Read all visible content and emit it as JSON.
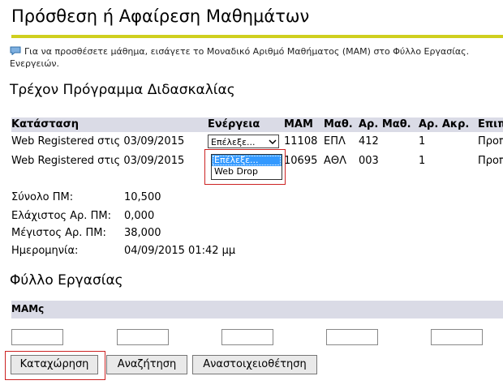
{
  "page": {
    "title": "Πρόσθεση ή Αφαίρεση Μαθημάτων"
  },
  "info": {
    "text": "Για να προσθέσετε μάθημα, εισάγετε το Μοναδικό Αριθμό Μαθήματος (MAM) στο Φύλλο Εργασίας. Ενεργειών."
  },
  "schedule": {
    "heading": "Τρέχον Πρόγραμμα Διδασκαλίας",
    "columns": [
      "Κατάσταση",
      "Ενέργεια",
      "MAM",
      "Μαθ.",
      "Αρ. Μαθ.",
      "Αρ. Ακρ.",
      "Επιπ"
    ],
    "rows": [
      {
        "status": "Web Registered στις 03/09/2015",
        "action": "Επέλεξε...",
        "mam": "11108",
        "subject": "ΕΠΛ",
        "course_no": "412",
        "section": "1",
        "level": "Προπ"
      },
      {
        "status": "Web Registered στις 03/09/2015",
        "action": "",
        "mam": "10695",
        "subject": "ΑΘΛ",
        "course_no": "003",
        "section": "1",
        "level": "Προπ"
      }
    ],
    "dropdown_options": [
      "Επέλεξε...",
      "Web Drop"
    ],
    "dropdown_selected_index": 0
  },
  "stats": [
    {
      "label": "Σύνολο ΠΜ:",
      "value": "10,500"
    },
    {
      "label": "Ελάχιστος Αρ. ΠΜ:",
      "value": "0,000"
    },
    {
      "label": "Μέγιστος Αρ. ΠΜ:",
      "value": "38,000"
    },
    {
      "label": "Ημερομηνία:",
      "value": "04/09/2015 01:42 μμ"
    }
  ],
  "worksheet": {
    "heading": "Φύλλο Εργασίας",
    "mam_label": "ΜΑΜς",
    "inputs": [
      "",
      "",
      "",
      "",
      "",
      ""
    ]
  },
  "buttons": {
    "submit": "Καταχώρηση",
    "search": "Αναζήτηση",
    "reset": "Αναστοιχειοθέτηση"
  },
  "colors": {
    "accent_rule": "#cfcf1e",
    "header_bg": "#dadbe6",
    "highlight_frame": "#cc2222"
  }
}
